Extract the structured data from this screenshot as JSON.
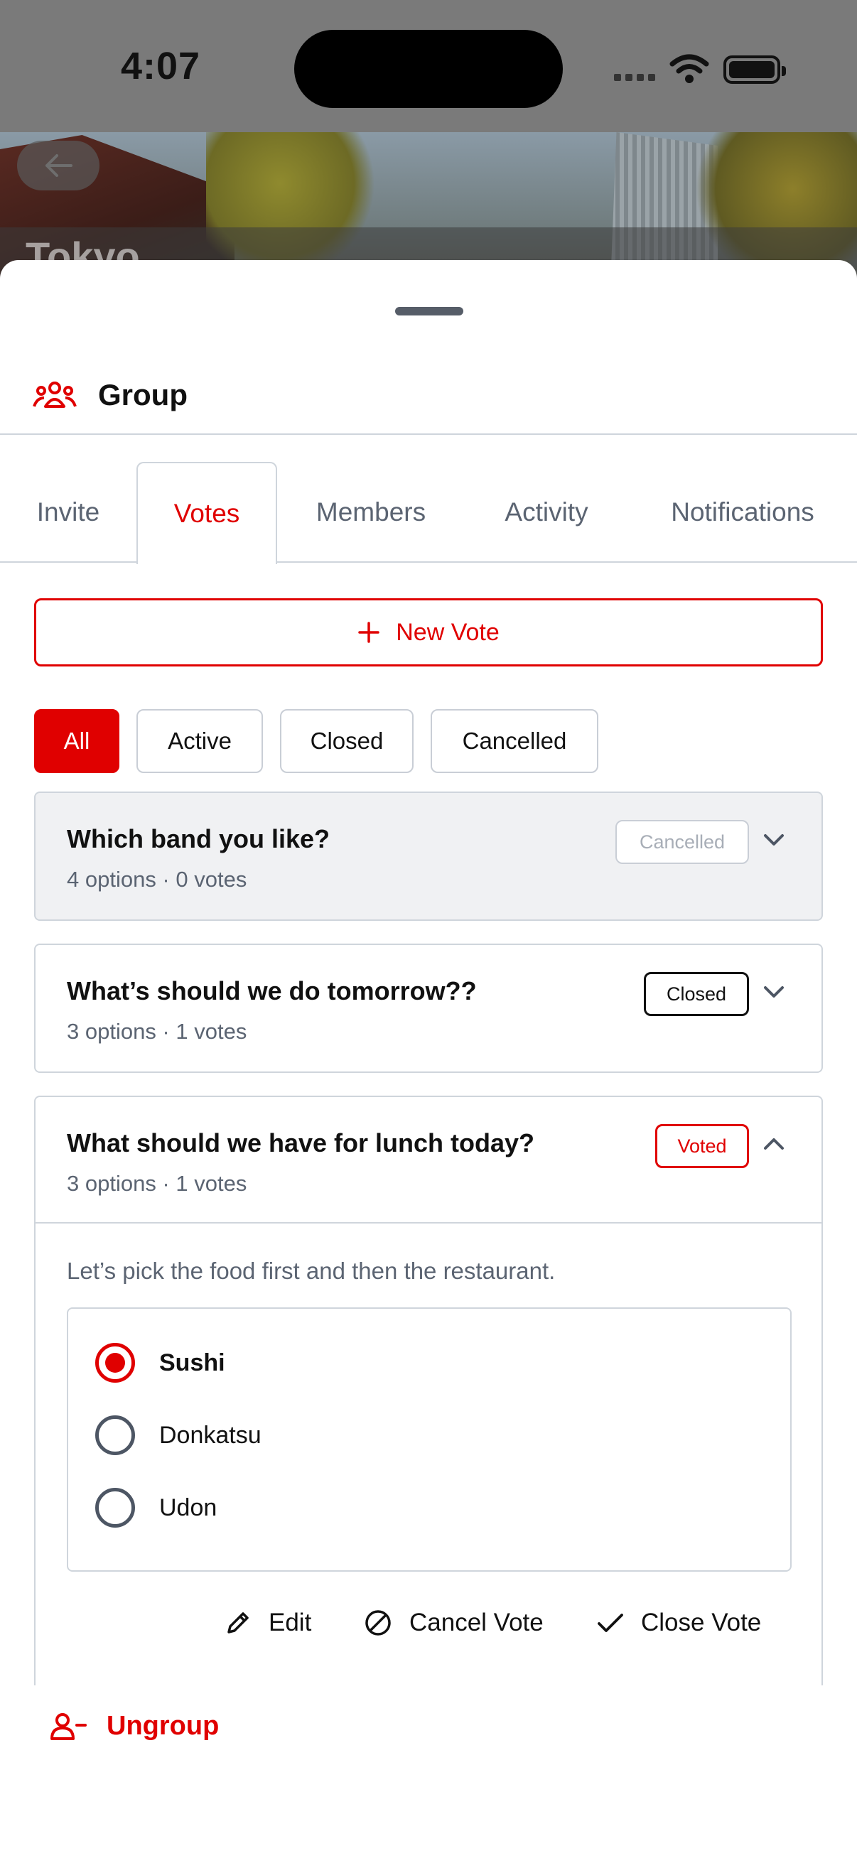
{
  "status_bar": {
    "time": "4:07"
  },
  "header": {
    "city": "Tokyo"
  },
  "sheet": {
    "title": "Group",
    "tabs": [
      "Invite",
      "Votes",
      "Members",
      "Activity",
      "Notifications"
    ],
    "active_tab": "Votes",
    "new_vote_label": "New Vote",
    "filters": [
      "All",
      "Active",
      "Closed",
      "Cancelled"
    ],
    "active_filter": "All",
    "votes": [
      {
        "question": "Which band you like?",
        "meta": "4 options · 0 votes",
        "status": "Cancelled",
        "expanded": false
      },
      {
        "question": "What’s should we do tomorrow??",
        "meta": "3 options · 1 votes",
        "status": "Closed",
        "expanded": false
      },
      {
        "question": "What should we have for lunch today?",
        "meta": "3 options · 1 votes",
        "status": "Voted",
        "expanded": true,
        "description": "Let’s pick the food first and then the restaurant.",
        "options": [
          {
            "label": "Sushi",
            "selected": true
          },
          {
            "label": "Donkatsu",
            "selected": false
          },
          {
            "label": "Udon",
            "selected": false
          }
        ],
        "actions": {
          "edit": "Edit",
          "cancel": "Cancel Vote",
          "close": "Close Vote"
        }
      }
    ],
    "ungroup_label": "Ungroup"
  },
  "colors": {
    "accent": "#e00000",
    "muted_text": "#5b6472",
    "border": "#cfd5dc"
  }
}
